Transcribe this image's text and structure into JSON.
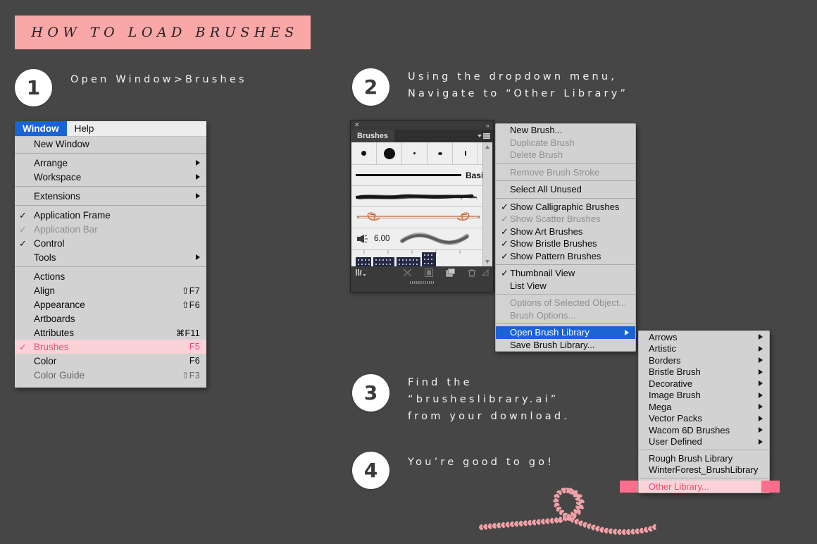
{
  "page": {
    "title": "HOW TO LOAD BRUSHES",
    "background_color": "#464646",
    "accent_pink": "#F9A7A7",
    "highlight_pink": "#FB6E8C",
    "row_pink": "#FBD2D8",
    "pink_text": "#ED4E6E",
    "selection_blue": "#1A63D4"
  },
  "steps": [
    {
      "number": "1",
      "text": "Open Window>Brushes"
    },
    {
      "number": "2",
      "text": "Using the dropdown menu,\nNavigate to “Other Library”"
    },
    {
      "number": "3",
      "text": "Find the\n“brusheslibrary.ai”\nfrom your download."
    },
    {
      "number": "4",
      "text": "You’re good to go!"
    }
  ],
  "window_menu": {
    "menubar": [
      {
        "label": "Window",
        "active": true
      },
      {
        "label": "Help",
        "active": false
      }
    ],
    "groups": [
      {
        "items": [
          {
            "label": "New Window",
            "shortcut": "",
            "check": "",
            "arrow": false,
            "disabled": false
          }
        ]
      },
      {
        "items": [
          {
            "label": "Arrange",
            "shortcut": "",
            "check": "",
            "arrow": true,
            "disabled": false
          },
          {
            "label": "Workspace",
            "shortcut": "",
            "check": "",
            "arrow": true,
            "disabled": false
          }
        ]
      },
      {
        "items": [
          {
            "label": "Extensions",
            "shortcut": "",
            "check": "",
            "arrow": true,
            "disabled": false
          }
        ]
      },
      {
        "items": [
          {
            "label": "Application Frame",
            "shortcut": "",
            "check": "✓",
            "arrow": false,
            "disabled": false
          },
          {
            "label": "Application Bar",
            "shortcut": "",
            "check": "✓",
            "arrow": false,
            "disabled": true
          },
          {
            "label": "Control",
            "shortcut": "",
            "check": "✓",
            "arrow": false,
            "disabled": false
          },
          {
            "label": "Tools",
            "shortcut": "",
            "check": "",
            "arrow": true,
            "disabled": false
          }
        ]
      },
      {
        "items": [
          {
            "label": "Actions",
            "shortcut": "",
            "check": "",
            "arrow": false,
            "disabled": false
          },
          {
            "label": "Align",
            "shortcut": "⇧F7",
            "check": "",
            "arrow": false,
            "disabled": false
          },
          {
            "label": "Appearance",
            "shortcut": "⇧F6",
            "check": "",
            "arrow": false,
            "disabled": false
          },
          {
            "label": "Artboards",
            "shortcut": "",
            "check": "",
            "arrow": false,
            "disabled": false
          },
          {
            "label": "Attributes",
            "shortcut": "⌘F11",
            "check": "",
            "arrow": false,
            "disabled": false
          },
          {
            "label": "Brushes",
            "shortcut": "F5",
            "check": "✓",
            "arrow": false,
            "disabled": false,
            "highlight": "pink"
          },
          {
            "label": "Color",
            "shortcut": "F6",
            "check": "",
            "arrow": false,
            "disabled": false
          },
          {
            "label": "Color Guide",
            "shortcut": "⇧F3",
            "check": "",
            "arrow": false,
            "disabled": false,
            "clipped": true
          }
        ]
      }
    ]
  },
  "brushes_panel": {
    "close_icon": "✕",
    "collapse_icon": "«",
    "tab_label": "Brushes",
    "basic_label": "Basic",
    "bristle_size": "6.00",
    "thumbnail_count": 5,
    "footer_icons": [
      "libraries-icon",
      "remove-brush-stroke-icon",
      "options-icon",
      "new-brush-icon",
      "delete-brush-icon"
    ]
  },
  "brush_context_menu": {
    "groups": [
      {
        "items": [
          {
            "label": "New Brush...",
            "disabled": false,
            "check": "",
            "arrow": false
          },
          {
            "label": "Duplicate Brush",
            "disabled": true,
            "check": "",
            "arrow": false
          },
          {
            "label": "Delete Brush",
            "disabled": true,
            "check": "",
            "arrow": false
          }
        ]
      },
      {
        "items": [
          {
            "label": "Remove Brush Stroke",
            "disabled": true,
            "check": "",
            "arrow": false
          }
        ]
      },
      {
        "items": [
          {
            "label": "Select All Unused",
            "disabled": false,
            "check": "",
            "arrow": false
          }
        ]
      },
      {
        "items": [
          {
            "label": "Show Calligraphic Brushes",
            "disabled": false,
            "check": "✓",
            "arrow": false
          },
          {
            "label": "Show Scatter Brushes",
            "disabled": true,
            "check": "✓",
            "arrow": false
          },
          {
            "label": "Show Art Brushes",
            "disabled": false,
            "check": "✓",
            "arrow": false
          },
          {
            "label": "Show Bristle Brushes",
            "disabled": false,
            "check": "✓",
            "arrow": false
          },
          {
            "label": "Show Pattern Brushes",
            "disabled": false,
            "check": "✓",
            "arrow": false
          }
        ]
      },
      {
        "items": [
          {
            "label": "Thumbnail View",
            "disabled": false,
            "check": "✓",
            "arrow": false
          },
          {
            "label": "List View",
            "disabled": false,
            "check": "",
            "arrow": false
          }
        ]
      },
      {
        "items": [
          {
            "label": "Options of Selected Object...",
            "disabled": true,
            "check": "",
            "arrow": false
          },
          {
            "label": "Brush Options...",
            "disabled": true,
            "check": "",
            "arrow": false
          }
        ]
      },
      {
        "items": [
          {
            "label": "Open Brush Library",
            "disabled": false,
            "check": "",
            "arrow": true,
            "selected": true
          },
          {
            "label": "Save Brush Library...",
            "disabled": false,
            "check": "",
            "arrow": false
          }
        ]
      }
    ]
  },
  "library_submenu": {
    "groups": [
      {
        "items": [
          {
            "label": "Arrows",
            "arrow": true
          },
          {
            "label": "Artistic",
            "arrow": true
          },
          {
            "label": "Borders",
            "arrow": true
          },
          {
            "label": "Bristle Brush",
            "arrow": true
          },
          {
            "label": "Decorative",
            "arrow": true
          },
          {
            "label": "Image Brush",
            "arrow": true
          },
          {
            "label": "Mega",
            "arrow": true
          },
          {
            "label": "Vector Packs",
            "arrow": true
          },
          {
            "label": "Wacom 6D Brushes",
            "arrow": true
          },
          {
            "label": "User Defined",
            "arrow": true
          }
        ]
      },
      {
        "items": [
          {
            "label": "Rough Brush Library",
            "arrow": false
          },
          {
            "label": "WinterForest_BrushLibrary",
            "arrow": false
          }
        ]
      },
      {
        "items": [
          {
            "label": "Other Library...",
            "arrow": false,
            "highlight": "pink"
          }
        ]
      }
    ]
  },
  "decoration": {
    "ribbon": "heart-ribbon-swirl",
    "ribbon_color": "#F2A0A8"
  }
}
